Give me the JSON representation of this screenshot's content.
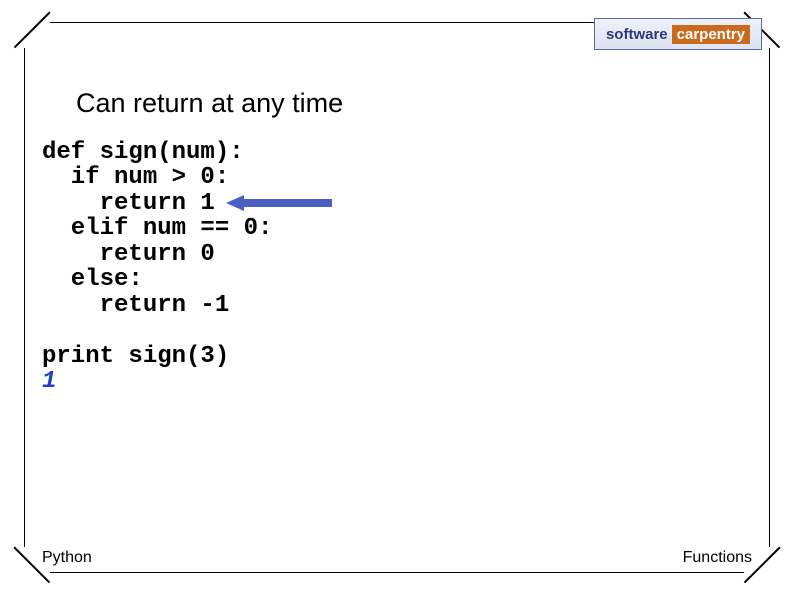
{
  "logo": {
    "word1": "software",
    "word2": "carpentry"
  },
  "title": "Can return at any time",
  "code": {
    "l1": "def sign(num):",
    "l2": "  if num > 0:",
    "l3": "    return 1",
    "l4": "  elif num == 0:",
    "l5": "    return 0",
    "l6": "  else:",
    "l7": "    return -1",
    "blank": "",
    "l8": "print sign(3)",
    "out": "1"
  },
  "footer": {
    "left": "Python",
    "right": "Functions"
  }
}
